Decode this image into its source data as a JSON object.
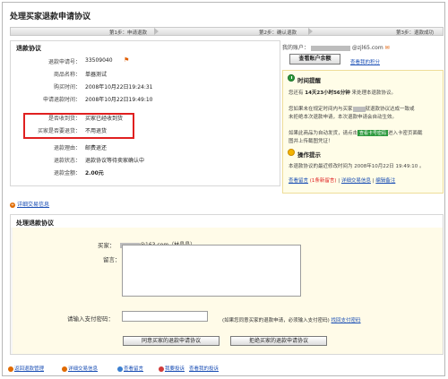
{
  "page": {
    "title": "处理买家退款申请协议",
    "steps": [
      "第1步：申请退款",
      "第2步：确认退款",
      "第3步：退款成功"
    ]
  },
  "refund": {
    "heading": "退款协议",
    "rows": [
      {
        "label": "退款申请号：",
        "value": "33509040"
      },
      {
        "label": "商品名称：",
        "value": "单器测试"
      },
      {
        "label": "购买时间：",
        "value": "2008年10月22日19:24:31"
      },
      {
        "label": "申请退款时间：",
        "value": "2008年10月22日19:49:10"
      },
      {
        "label": "是否收到货：",
        "value": "买家已经收到货"
      },
      {
        "label": "买家是否要退货：",
        "value": "不用退货"
      },
      {
        "label": "退款理由：",
        "value": "邮费退还"
      },
      {
        "label": "退款状态：",
        "value": "退款协议等待卖家确认中"
      },
      {
        "label": "退款金额：",
        "value": "2.00元"
      }
    ]
  },
  "account": {
    "label": "我的账户：",
    "domain": "@zjl65.com",
    "balance_button": "查看账户余额",
    "points_link": "查看我的积分"
  },
  "time_reminder": {
    "title": "时间提醒",
    "line1_prefix": "您还有",
    "countdown": "14天23小时56分钟",
    "line1_suffix": "来处理本退款协议。",
    "line2": "您如果未在规定时间内与买家",
    "line2b": "就退款协议达成一致或",
    "line3": "未拒绝本次退款申请，本次退款申请会自动生效。",
    "line4_prefix": "如果此商品为自动发货，请点击",
    "green_button": "查看卡号密码",
    "line4_suffix": "进入卡密页面截",
    "line5": "图并上传截图凭证！"
  },
  "op_tips": {
    "title": "操作提示",
    "line1": "本退款协议的最近修改时间为 2008年10月22日 19:49:10 。",
    "links": [
      "查看留言",
      "(1条新留言)",
      "详细交易信息",
      "编辑备注"
    ]
  },
  "detail_link": "详细交易信息",
  "process": {
    "heading": "处理退款协议",
    "buyer_label": "买家：",
    "buyer_value": "@163.com（林晶晶）",
    "message_label": "留言：",
    "pwd_label": "请输入支付密码：",
    "pwd_hint": "(如果您同意买家的退款申请，必须输入支付密码)",
    "retrieve_link": "找回支付密码",
    "agree_button": "同意买家的退款申请协议",
    "reject_button": "拒绝买家的退款申请协议"
  },
  "footer": [
    "返回退款管理",
    "详细交易信息",
    "查看留言",
    "我要投诉",
    "查看我的投诉"
  ],
  "colors": {
    "highlight": "#e02020",
    "link": "#1b4fb5",
    "notice_bg": "#fffde8"
  }
}
